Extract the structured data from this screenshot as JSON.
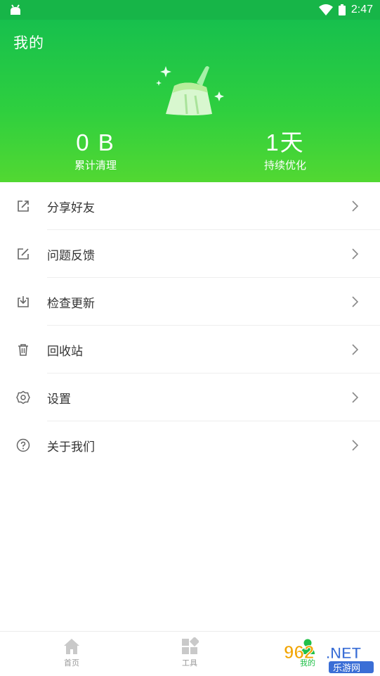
{
  "status_bar": {
    "time": "2:47"
  },
  "header": {
    "title": "我的",
    "stats": [
      {
        "value": "0 B",
        "label": "累计清理"
      },
      {
        "value": "1天",
        "label": "持续优化"
      }
    ]
  },
  "menu": [
    {
      "label": "分享好友",
      "icon": "share-icon"
    },
    {
      "label": "问题反馈",
      "icon": "edit-icon"
    },
    {
      "label": "检查更新",
      "icon": "download-icon"
    },
    {
      "label": "回收站",
      "icon": "trash-icon"
    },
    {
      "label": "设置",
      "icon": "gear-icon"
    },
    {
      "label": "关于我们",
      "icon": "help-icon"
    }
  ],
  "bottom_nav": [
    {
      "label": "首页",
      "icon": "home-icon"
    },
    {
      "label": "工具",
      "icon": "grid-icon"
    },
    {
      "label": "我的",
      "icon": "user-icon"
    }
  ],
  "watermark": {
    "text": "962.NET",
    "subtext": "乐游网"
  },
  "colors": {
    "accent": "#17b548",
    "header_end": "#52d832"
  }
}
